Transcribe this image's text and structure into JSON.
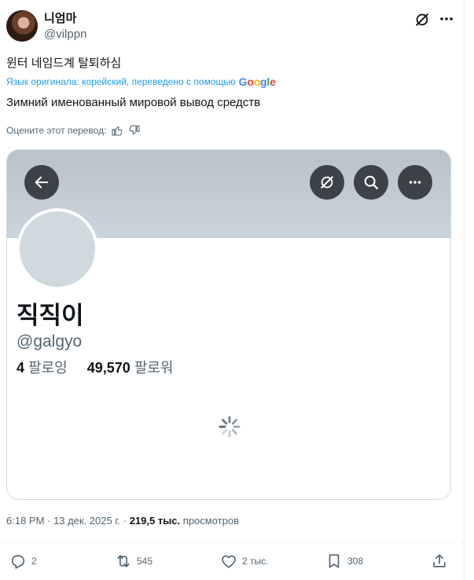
{
  "tweet": {
    "author": {
      "name": "니엄마",
      "handle": "@vilppn"
    },
    "text": "윈터 네임드계 탈퇴하심",
    "translation": {
      "notice": "Язык оригинала: корейский, переведено с помощью",
      "engine": "Google",
      "text": "Зимний именованный мировой вывод средств"
    },
    "rate_label": "Оцените этот перевод:",
    "time": "6:18 PM",
    "date": "13 дек. 2025 г.",
    "views": "219,5 тыс.",
    "views_label": "просмотров"
  },
  "embedded_profile": {
    "name": "직직이",
    "handle": "@galgyo",
    "following_count": "4",
    "following_label": "팔로잉",
    "followers_count": "49,570",
    "followers_label": "팔로워"
  },
  "actions": {
    "replies": "2",
    "reposts": "545",
    "likes": "2 тыс.",
    "bookmarks": "308"
  },
  "icons": [
    "grok-icon",
    "more-icon",
    "back-arrow-icon",
    "search-icon",
    "thumbs-up-icon",
    "thumbs-down-icon",
    "reply-icon",
    "repost-icon",
    "like-icon",
    "bookmark-icon",
    "share-icon",
    "spinner-icon"
  ],
  "colors": {
    "accent": "#1d9bf0",
    "text": "#0f1419",
    "muted": "#536471",
    "banner": "#c3ccd4"
  }
}
